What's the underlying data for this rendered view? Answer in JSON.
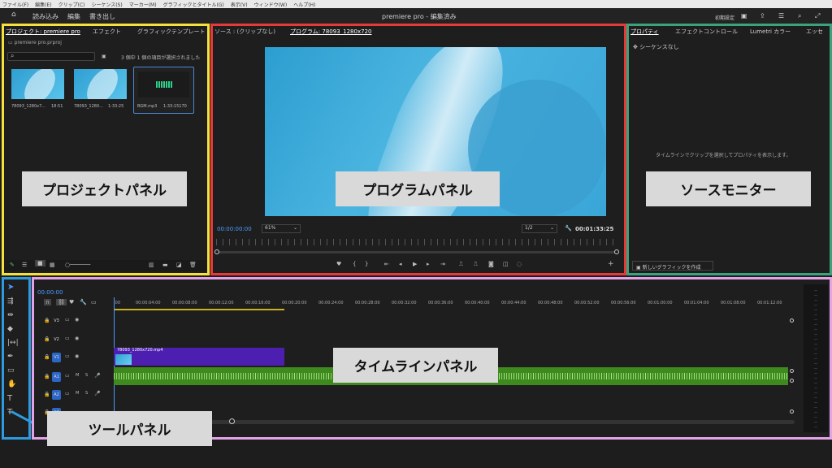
{
  "menu": [
    "ファイル(F)",
    "編集(E)",
    "クリップ(C)",
    "シーケンス(S)",
    "マーカー(M)",
    "グラフィックとタイトル(G)",
    "表示(V)",
    "ウィンドウ(W)",
    "ヘルプ(H)"
  ],
  "workspace": {
    "import": "読み込み",
    "edit": "編集",
    "export": "書き出し",
    "title": "premiere pro - 編集済み",
    "preset": "初期設定"
  },
  "project": {
    "tabs": [
      "プロジェクト: premiere pro",
      "エフェクト",
      "グラフィックテンプレート"
    ],
    "file": "premiere pro.prproj",
    "selection": "3 個中 1 個の項目が選択されました",
    "items": [
      {
        "name": "78093_1280x7...",
        "duration": "18:51"
      },
      {
        "name": "78093_1280...",
        "duration": "1:33:25"
      },
      {
        "name": "BGM.mp3",
        "duration": "1:33:15170"
      }
    ]
  },
  "program": {
    "tabs": [
      "ソース : (クリップなし)",
      "プログラム: 78093_1280x720"
    ],
    "timecode": "00:00:00:00",
    "zoom": "61%",
    "quality": "1/2",
    "duration": "00:01:33:25"
  },
  "properties": {
    "tabs": [
      "プロパティ",
      "エフェクトコントロール",
      "Lumetri カラー",
      "エッセ"
    ],
    "sequence": "シーケンスなし",
    "hint": "タイムラインでクリップを選択してプロパティを表示します。",
    "new_graphic": "新しいグラフィックを作成"
  },
  "timeline": {
    "timecode": "00:00:00",
    "ruler": [
      ":00",
      "00:00:04:00",
      "00:00:08:00",
      "00:00:12:00",
      "00:00:16:00",
      "00:00:20:00",
      "00:00:24:00",
      "00:00:28:00",
      "00:00:32:00",
      "00:00:36:00",
      "00:00:40:00",
      "00:00:44:00",
      "00:00:48:00",
      "00:00:52:00",
      "00:00:56:00",
      "00:01:00:00",
      "00:01:04:00",
      "00:01:08:00",
      "00:01:12:00"
    ],
    "video_tracks": [
      "V3",
      "V2",
      "V1"
    ],
    "audio_tracks": [
      "A1",
      "A2",
      "A3"
    ],
    "clip": "78093_1280x720.mp4",
    "track_letters": {
      "mute": "M",
      "solo": "S"
    }
  },
  "labels": {
    "project": "プロジェクトパネル",
    "program": "プログラムパネル",
    "source": "ソースモニター",
    "timeline": "タイムラインパネル",
    "tools": "ツールパネル"
  },
  "colors": {
    "project": "#f5e13a",
    "program": "#e63a3a",
    "source": "#3aa37b",
    "timeline": "#e3a3e6",
    "tools": "#2e9be0",
    "clip": "#4d1fb0",
    "audio": "#3f8a1f"
  }
}
